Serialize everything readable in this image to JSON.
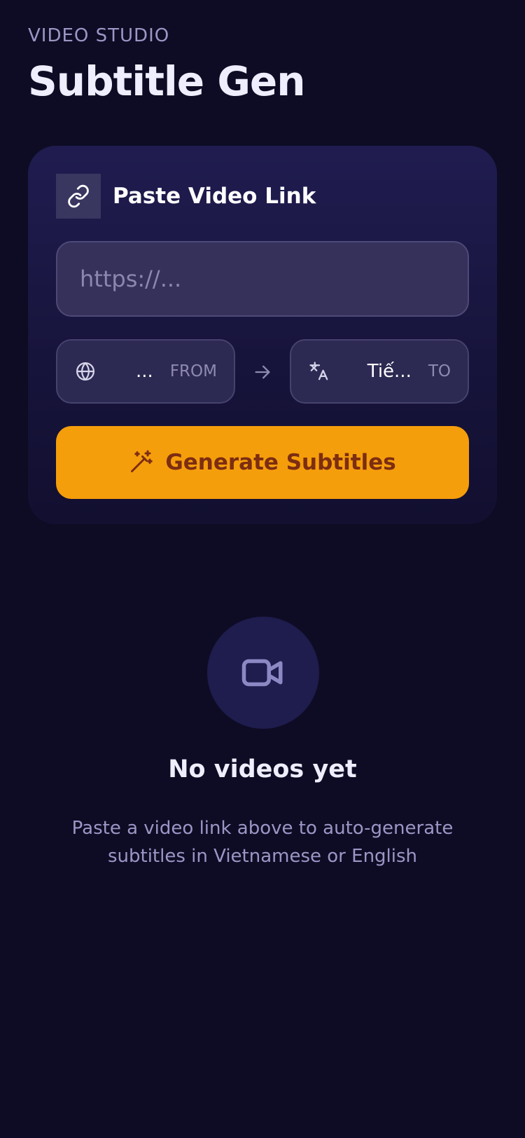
{
  "header": {
    "overline": "VIDEO STUDIO",
    "title": "Subtitle Gen"
  },
  "card": {
    "title": "Paste Video Link",
    "link_icon": "link-icon",
    "url_input": {
      "value": "",
      "placeholder": "https://..."
    },
    "source_language": {
      "icon": "globe-icon",
      "value": "...",
      "label": "FROM"
    },
    "arrow_icon": "arrow-right-icon",
    "target_language": {
      "icon": "translate-icon",
      "value": "Tiế...",
      "label": "TO"
    },
    "generate_button": {
      "icon": "magic-wand-icon",
      "label": "Generate Subtitles"
    }
  },
  "empty_state": {
    "icon": "video-camera-icon",
    "title": "No videos yet",
    "description": "Paste a video link above to auto-generate subtitles in Vietnamese or English"
  },
  "colors": {
    "background": "#0e0c24",
    "card": "#201c50",
    "accent": "#f59e0b",
    "accent_text": "#7c2d12",
    "muted_text": "#9b96c6"
  }
}
